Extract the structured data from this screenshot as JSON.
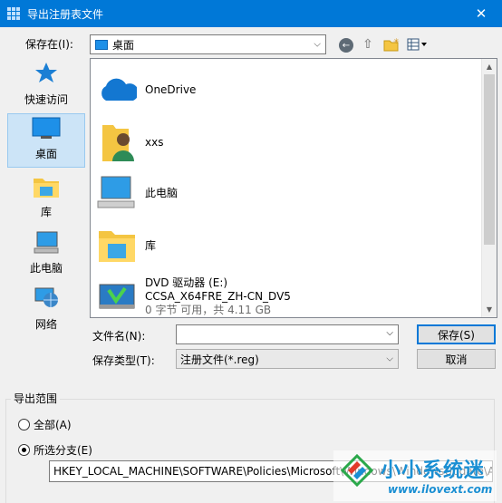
{
  "window": {
    "title": "导出注册表文件",
    "close": "✕"
  },
  "lookin": {
    "label": "保存在(I):",
    "value": "桌面"
  },
  "places": [
    {
      "label": "快速访问",
      "icon": "star-icon"
    },
    {
      "label": "桌面",
      "icon": "desktop-icon",
      "selected": true
    },
    {
      "label": "库",
      "icon": "library-icon"
    },
    {
      "label": "此电脑",
      "icon": "computer-icon"
    },
    {
      "label": "网络",
      "icon": "network-icon"
    }
  ],
  "files": [
    {
      "name": "OneDrive",
      "icon": "cloud-icon"
    },
    {
      "name": "xxs",
      "icon": "user-folder-icon"
    },
    {
      "name": "此电脑",
      "icon": "computer-icon"
    },
    {
      "name": "库",
      "icon": "library-icon"
    },
    {
      "name": "DVD 驱动器 (E:)",
      "line2": "CCSA_X64FRE_ZH-CN_DV5",
      "line3": "0 字节 可用，共 4.11 GB",
      "icon": "dvd-drive-icon"
    }
  ],
  "filename": {
    "label": "文件名(N):",
    "value": ""
  },
  "filetype": {
    "label": "保存类型(T):",
    "value": "注册文件(*.reg)"
  },
  "buttons": {
    "save": "保存(S)",
    "cancel": "取消"
  },
  "export_range": {
    "label": "导出范围",
    "all": "全部(A)",
    "selected_branch": "所选分支(E)",
    "branch_path": "HKEY_LOCAL_MACHINE\\SOFTWARE\\Policies\\Microsoft\\Windows\\WindowsUpdate\\AU"
  },
  "watermark": {
    "name": "小小系统迷",
    "url": "www.ilovext.com"
  },
  "colors": {
    "titlebar": "#0078d7",
    "selection": "#cce4f7",
    "watermark": "#1a8fd3"
  }
}
